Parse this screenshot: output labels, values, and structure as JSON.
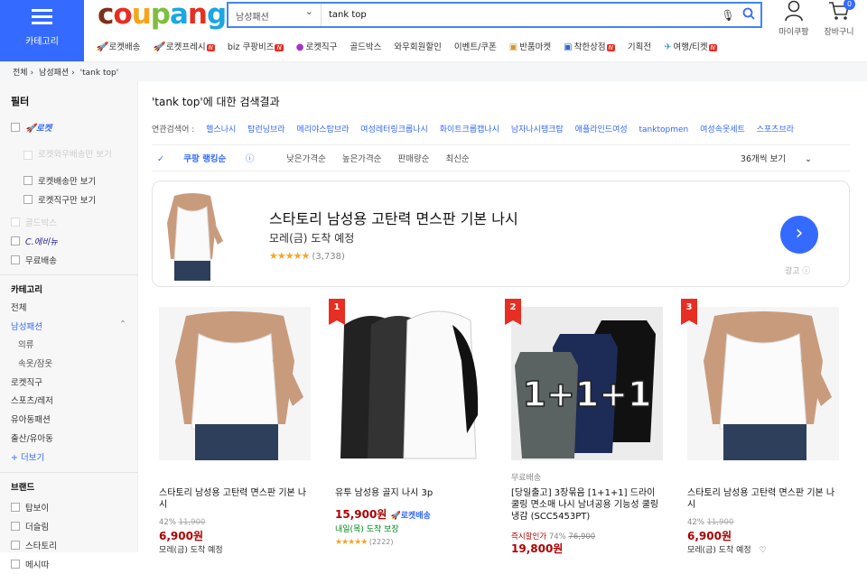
{
  "header": {
    "category_label": "카테고리",
    "logo": [
      "c",
      "o",
      "u",
      "p",
      "a",
      "n",
      "g"
    ],
    "search_category": "남성패션",
    "search_query": "tank top",
    "mypage": "마이쿠팡",
    "cart": "장바구니",
    "cart_count": "0",
    "quick_links": [
      {
        "icon": "rocket-icon",
        "label": "로켓배송",
        "new": false
      },
      {
        "icon": "rocket-fresh-icon",
        "label": "로켓프레시",
        "new": true
      },
      {
        "icon": "biz-icon",
        "label": "biz 쿠팡비즈",
        "new": true
      },
      {
        "icon": "global-icon",
        "label": "로켓직구",
        "new": false
      },
      {
        "icon": "",
        "label": "골드박스",
        "new": false
      },
      {
        "icon": "",
        "label": "와우회원할인",
        "new": false
      },
      {
        "icon": "",
        "label": "이벤트/쿠폰",
        "new": false
      },
      {
        "icon": "market-icon",
        "label": "반품마켓",
        "new": false
      },
      {
        "icon": "shop-icon",
        "label": "착한상점",
        "new": true
      },
      {
        "icon": "",
        "label": "기획전",
        "new": false
      },
      {
        "icon": "plane-icon",
        "label": "여행/티켓",
        "new": true
      }
    ]
  },
  "breadcrumb": [
    "전체",
    "남성패션",
    "'tank top'"
  ],
  "sidebar": {
    "title": "필터",
    "rocket": "로켓",
    "rocket_opts": [
      "로켓와우배송만 보기",
      "로켓배송만 보기",
      "로켓직구만 보기"
    ],
    "gold": "골드박스",
    "cevery": "C.에비뉴",
    "free": "무료배송",
    "category_title": "카테고리",
    "categories": [
      {
        "label": "전체",
        "state": "normal"
      },
      {
        "label": "남성패션",
        "state": "on"
      },
      {
        "label": "의류",
        "state": "sub"
      },
      {
        "label": "속옷/잠옷",
        "state": "sub"
      },
      {
        "label": "로켓직구",
        "state": "normal"
      },
      {
        "label": "스포츠/레저",
        "state": "normal"
      },
      {
        "label": "유아동패션",
        "state": "normal"
      },
      {
        "label": "출산/유아동",
        "state": "normal"
      }
    ],
    "more": "+ 더보기",
    "brand_title": "브랜드",
    "brands": [
      "탑보이",
      "더슬림",
      "스타토리",
      "메시따"
    ]
  },
  "main": {
    "result_title_q": "'tank top'",
    "result_title_rest": "에 대한 검색결과",
    "related_label": "연관검색어 :",
    "related": [
      "헬스나시",
      "탑런닝브라",
      "메리야스탑브라",
      "여성레터링크롭나시",
      "화이트크롭캡나시",
      "남자나시탱크탑",
      "애플라인드여성",
      "tanktopmen",
      "여성속옷세트",
      "스포츠브라"
    ],
    "sort": [
      "쿠팡 랭킹순",
      "낮은가격순",
      "높은가격순",
      "판매량순",
      "최신순"
    ],
    "per_page": "36개씩 보기"
  },
  "ad": {
    "title": "스타토리 남성용 고탄력 면스판 기본 나시",
    "delivery": "모레(금) 도착 예정",
    "rating": 4.5,
    "reviews": "(3,738)",
    "ad_label": "광고"
  },
  "products": [
    {
      "rank": "",
      "free": "",
      "name": "스타토리 남성용 고탄력 면스판 기본 나시",
      "discount": "42%",
      "orig": "11,900",
      "price": "6,900원",
      "rocket": false,
      "delivery": "모레(금) 도착 예정",
      "rating": 0,
      "reviews": "",
      "instant": ""
    },
    {
      "rank": "1",
      "free": "",
      "name": "유투 남성용 골지 나시 3p",
      "discount": "",
      "orig": "",
      "price": "15,900원",
      "rocket": true,
      "rocket_label": "로켓배송",
      "delivery": "내일(목) 도착 보장",
      "rating": 4.5,
      "reviews": "(2222)",
      "instant": ""
    },
    {
      "rank": "2",
      "free": "무료배송",
      "name": "[당일출고] 3장묶음 [1+1+1] 드라이 쿨링 면소매 나시 남녀공용 기능성 쿨링 냉감 (SCC5453PT)",
      "discount": "74%",
      "orig": "76,900",
      "price": "19,800원",
      "rocket": false,
      "delivery": "",
      "rating": 0,
      "reviews": "",
      "instant": "즉시할인가"
    },
    {
      "rank": "3",
      "free": "",
      "name": "스타토리 남성용 고탄력 면스판 기본 나시",
      "discount": "42%",
      "orig": "11,900",
      "price": "6,900원",
      "rocket": false,
      "delivery": "모레(금) 도착 예정",
      "rating": 0,
      "reviews": "",
      "instant": ""
    }
  ],
  "overlay_text": "1+1+1",
  "colors": {
    "brand": "#346aff",
    "price": "#ae0000",
    "rank": "#e62f22",
    "star": "#f5a623"
  }
}
